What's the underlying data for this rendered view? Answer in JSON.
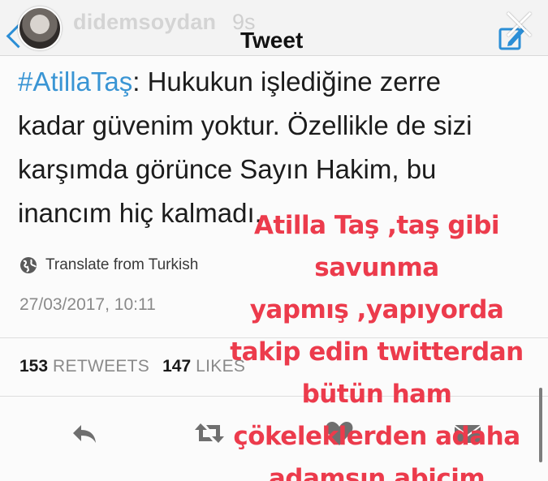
{
  "story": {
    "username": "didemsoydan",
    "time_ago": "9s",
    "caption_lines": [
      "Atilla Taş ,taş gibi",
      "savunma",
      "yapmış ,yapıyorda",
      "takip edin twitterdan",
      "bütün ham",
      "çökeleklerden adaha",
      "adamsın abicim"
    ],
    "caption_color": "#ec3b4c"
  },
  "nav": {
    "title": "Tweet",
    "back_icon": "chevron-left-icon",
    "compose_icon": "compose-icon",
    "close_icon": "close-icon"
  },
  "tweet": {
    "hashtag": "#AtillaTaş",
    "text_lines": [
      ": Hukukun işlediğine zerre",
      "kadar güvenim yoktur. Özellikle de sizi",
      "karşımda görünce Sayın Hakim, bu",
      "inancım hiç kalmadı."
    ],
    "translate_label": "Translate from Turkish",
    "timestamp": "27/03/2017, 10:11",
    "retweets_count": "153",
    "retweets_label": "RETWEETS",
    "likes_count": "147",
    "likes_label": "LIKES"
  },
  "actions": {
    "reply_icon": "reply-icon",
    "retweet_icon": "retweet-icon",
    "like_icon": "heart-icon",
    "share_icon": "share-icon"
  },
  "colors": {
    "accent": "#3a95d4",
    "text": "#1c1c1c",
    "muted": "#8a8a8a"
  }
}
